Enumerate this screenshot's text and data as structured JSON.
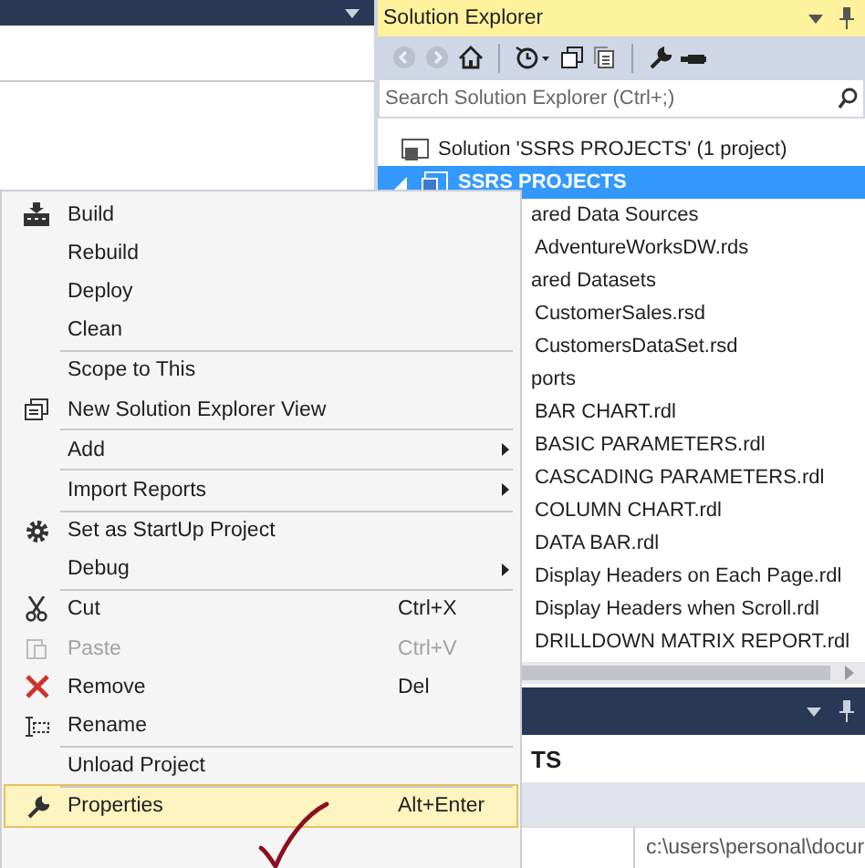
{
  "solution_explorer": {
    "title": "Solution Explorer",
    "search": {
      "placeholder": "Search Solution Explorer (Ctrl+;)"
    },
    "tree": [
      {
        "label": "Solution 'SSRS PROJECTS' (1 project)",
        "selected": false,
        "children": [
          {
            "label": "SSRS PROJECTS",
            "selected": true,
            "expanded": true,
            "children": [
              {
                "label": "ared Data Sources",
                "selected": false,
                "children": [
                  {
                    "label": "AdventureWorksDW.rds",
                    "selected": false
                  }
                ]
              },
              {
                "label": "ared Datasets",
                "selected": false,
                "children": [
                  {
                    "label": "CustomerSales.rsd",
                    "selected": false
                  },
                  {
                    "label": "CustomersDataSet.rsd",
                    "selected": false
                  }
                ]
              },
              {
                "label": "ports",
                "selected": false,
                "children": [
                  {
                    "label": "BAR CHART.rdl",
                    "selected": false
                  },
                  {
                    "label": "BASIC PARAMETERS.rdl",
                    "selected": false
                  },
                  {
                    "label": "CASCADING PARAMETERS.rdl",
                    "selected": false
                  },
                  {
                    "label": "COLUMN CHART.rdl",
                    "selected": false
                  },
                  {
                    "label": "DATA BAR.rdl",
                    "selected": false
                  },
                  {
                    "label": "Display Headers on Each Page.rdl",
                    "selected": false
                  },
                  {
                    "label": "Display Headers when Scroll.rdl",
                    "selected": false
                  },
                  {
                    "label": "DRILLDOWN MATRIX REPORT.rdl",
                    "selected": false
                  }
                ]
              }
            ]
          }
        ]
      }
    ]
  },
  "properties_panel": {
    "heading": "TS",
    "path": "c:\\users\\personal\\docur"
  },
  "context_menu": [
    {
      "label": "Build",
      "separator_before": false,
      "submenu": false,
      "disabled": false,
      "selected": false
    },
    {
      "label": "Rebuild",
      "separator_before": false,
      "submenu": false,
      "disabled": false,
      "selected": false
    },
    {
      "label": "Deploy",
      "separator_before": false,
      "submenu": false,
      "disabled": false,
      "selected": false
    },
    {
      "label": "Clean",
      "separator_before": false,
      "submenu": false,
      "disabled": false,
      "selected": false
    },
    {
      "label": "Scope to This",
      "separator_before": true,
      "submenu": false,
      "disabled": false,
      "selected": false
    },
    {
      "label": "New Solution Explorer View",
      "separator_before": false,
      "submenu": false,
      "disabled": false,
      "selected": false
    },
    {
      "label": "Add",
      "separator_before": true,
      "submenu": true,
      "disabled": false,
      "selected": false
    },
    {
      "label": "Import Reports",
      "separator_before": true,
      "submenu": true,
      "disabled": false,
      "selected": false
    },
    {
      "label": "Set as StartUp Project",
      "separator_before": true,
      "submenu": false,
      "disabled": false,
      "selected": false
    },
    {
      "label": "Debug",
      "separator_before": false,
      "submenu": true,
      "disabled": false,
      "selected": false
    },
    {
      "label": "Cut",
      "shortcut": "Ctrl+X",
      "separator_before": true,
      "submenu": false,
      "disabled": false,
      "selected": false
    },
    {
      "label": "Paste",
      "shortcut": "Ctrl+V",
      "separator_before": false,
      "submenu": false,
      "disabled": true,
      "selected": false
    },
    {
      "label": "Remove",
      "shortcut": "Del",
      "separator_before": false,
      "submenu": false,
      "disabled": false,
      "selected": false
    },
    {
      "label": "Rename",
      "separator_before": false,
      "submenu": false,
      "disabled": false,
      "selected": false
    },
    {
      "label": "Unload Project",
      "separator_before": true,
      "submenu": false,
      "disabled": false,
      "selected": false
    },
    {
      "label": "Properties",
      "shortcut": "Alt+Enter",
      "separator_before": true,
      "submenu": false,
      "disabled": false,
      "selected": true
    }
  ]
}
